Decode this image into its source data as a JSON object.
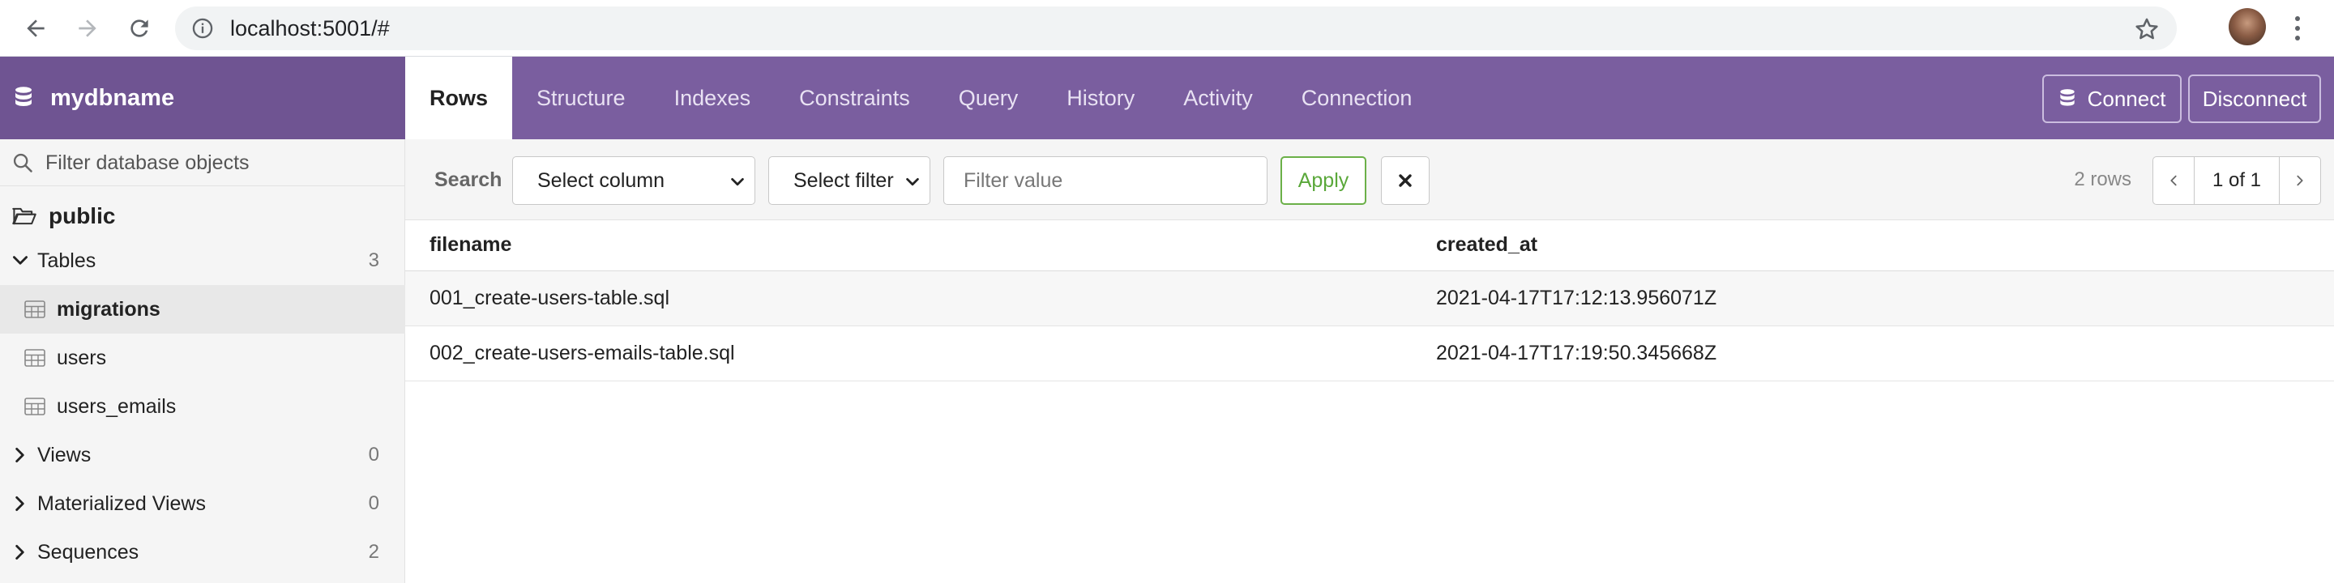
{
  "browser": {
    "url": "localhost:5001/#",
    "icons": [
      "back-icon",
      "forward-icon",
      "reload-icon",
      "info-icon",
      "star-icon",
      "kebab-menu-icon"
    ]
  },
  "header": {
    "db_name": "mydbname",
    "tabs": [
      {
        "label": "Rows",
        "active": true
      },
      {
        "label": "Structure",
        "active": false
      },
      {
        "label": "Indexes",
        "active": false
      },
      {
        "label": "Constraints",
        "active": false
      },
      {
        "label": "Query",
        "active": false
      },
      {
        "label": "History",
        "active": false
      },
      {
        "label": "Activity",
        "active": false
      },
      {
        "label": "Connection",
        "active": false
      }
    ],
    "connect_label": "Connect",
    "disconnect_label": "Disconnect",
    "accent_color": "#7a5e9f"
  },
  "sidebar": {
    "filter_placeholder": "Filter database objects",
    "schema": "public",
    "sections": {
      "tables": {
        "label": "Tables",
        "count": "3",
        "expanded": true
      },
      "views": {
        "label": "Views",
        "count": "0",
        "expanded": false
      },
      "materialized_views": {
        "label": "Materialized Views",
        "count": "0",
        "expanded": false
      },
      "sequences": {
        "label": "Sequences",
        "count": "2",
        "expanded": false
      }
    },
    "tables": [
      {
        "name": "migrations",
        "selected": true
      },
      {
        "name": "users",
        "selected": false
      },
      {
        "name": "users_emails",
        "selected": false
      }
    ]
  },
  "toolbar": {
    "search_label": "Search",
    "select_column": "Select column",
    "select_filter": "Select filter",
    "filter_value_placeholder": "Filter value",
    "apply_label": "Apply",
    "rows_count": "2 rows",
    "page_indicator": "1 of 1"
  },
  "results": {
    "columns": [
      "filename",
      "created_at"
    ],
    "rows": [
      [
        "001_create-users-table.sql",
        "2021-04-17T17:12:13.956071Z"
      ],
      [
        "002_create-users-emails-table.sql",
        "2021-04-17T17:19:50.345668Z"
      ]
    ]
  }
}
